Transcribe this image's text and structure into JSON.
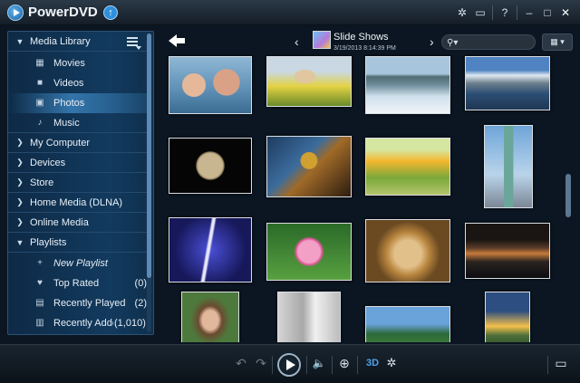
{
  "app": {
    "title": "PowerDVD"
  },
  "titlebar": {
    "settings_icon": "gear-icon",
    "tv_icon": "tv-icon",
    "help_label": "?",
    "minimize_label": "–",
    "maximize_label": "□",
    "close_label": "✕"
  },
  "sidebar": {
    "media_library": "Media Library",
    "items": [
      {
        "label": "Movies",
        "icon": "film-icon"
      },
      {
        "label": "Videos",
        "icon": "camera-icon"
      },
      {
        "label": "Photos",
        "icon": "picture-icon",
        "selected": true
      },
      {
        "label": "Music",
        "icon": "music-note-icon"
      }
    ],
    "sections": [
      "My Computer",
      "Devices",
      "Store",
      "Home Media (DLNA)",
      "Online Media"
    ],
    "playlists": "Playlists",
    "playlist_items": [
      {
        "label": "New Playlist",
        "count": ""
      },
      {
        "label": "Top Rated",
        "count": "(0)"
      },
      {
        "label": "Recently Played",
        "count": "(2)"
      },
      {
        "label": "Recently Added",
        "count": "(1,010)"
      }
    ]
  },
  "album": {
    "title": "Slide Shows",
    "date": "3/19/2013 8:14:39 PM"
  },
  "search": {
    "placeholder": "",
    "value": ""
  },
  "view": {
    "label": "▦ ▾"
  },
  "photos": [
    {
      "name": "couple"
    },
    {
      "name": "dog-in-flowers"
    },
    {
      "name": "lake-reflection"
    },
    {
      "name": "mountain-lake"
    },
    {
      "name": "moon"
    },
    {
      "name": "butterfly-wing"
    },
    {
      "name": "bicycle-field"
    },
    {
      "name": "statue-of-liberty"
    },
    {
      "name": "lightning"
    },
    {
      "name": "lotus-flower"
    },
    {
      "name": "lion"
    },
    {
      "name": "bridge-night"
    },
    {
      "name": "woman-portrait"
    },
    {
      "name": "misty-forest"
    },
    {
      "name": "mountain-meadow"
    },
    {
      "name": "sunset-field"
    }
  ],
  "controls": {
    "undo": "↶",
    "redo": "↷",
    "volume": "🔈",
    "zoom": "⊕",
    "threed": "3D",
    "settings": "✲",
    "tv_out": "▭"
  }
}
